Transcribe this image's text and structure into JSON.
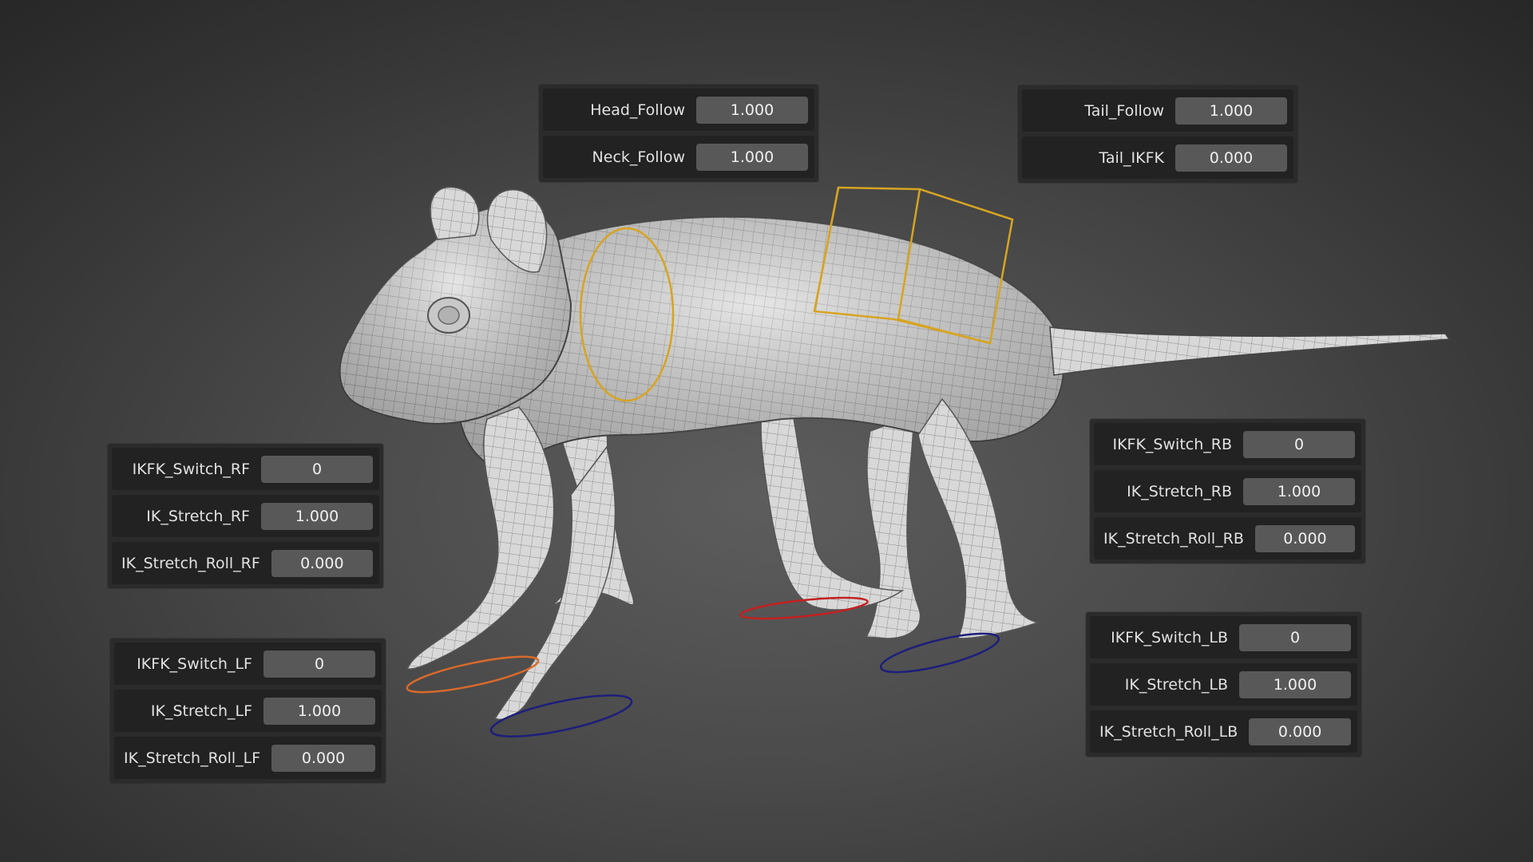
{
  "colors": {
    "background": "#3f3f3f",
    "panel": "#2b2b2b",
    "row": "#222222",
    "field": "#585858",
    "text": "#e2e2e2",
    "controller_neck_chest": "#d7a422",
    "controller_left_front": "#d86a2a",
    "controller_right_back": "#c42020",
    "controller_feet_other": "#1c1f7a"
  },
  "viewport": {
    "subject": "rig-model",
    "controllers": [
      "neck-controller",
      "chest-controller",
      "foot-controller-lf",
      "foot-controller-rf",
      "foot-controller-rb",
      "foot-controller-lb"
    ]
  },
  "panels": {
    "head": {
      "rows": [
        {
          "label": "Head_Follow",
          "value": "1.000"
        },
        {
          "label": "Neck_Follow",
          "value": "1.000"
        }
      ]
    },
    "tail": {
      "rows": [
        {
          "label": "Tail_Follow",
          "value": "1.000"
        },
        {
          "label": "Tail_IKFK",
          "value": "0.000"
        }
      ]
    },
    "rf": {
      "rows": [
        {
          "label": "IKFK_Switch_RF",
          "value": "0"
        },
        {
          "label": "IK_Stretch_RF",
          "value": "1.000"
        },
        {
          "label": "IK_Stretch_Roll_RF",
          "value": "0.000"
        }
      ]
    },
    "lf": {
      "rows": [
        {
          "label": "IKFK_Switch_LF",
          "value": "0"
        },
        {
          "label": "IK_Stretch_LF",
          "value": "1.000"
        },
        {
          "label": "IK_Stretch_Roll_LF",
          "value": "0.000"
        }
      ]
    },
    "rb": {
      "rows": [
        {
          "label": "IKFK_Switch_RB",
          "value": "0"
        },
        {
          "label": "IK_Stretch_RB",
          "value": "1.000"
        },
        {
          "label": "IK_Stretch_Roll_RB",
          "value": "0.000"
        }
      ]
    },
    "lb": {
      "rows": [
        {
          "label": "IKFK_Switch_LB",
          "value": "0"
        },
        {
          "label": "IK_Stretch_LB",
          "value": "1.000"
        },
        {
          "label": "IK_Stretch_Roll_LB",
          "value": "0.000"
        }
      ]
    }
  }
}
